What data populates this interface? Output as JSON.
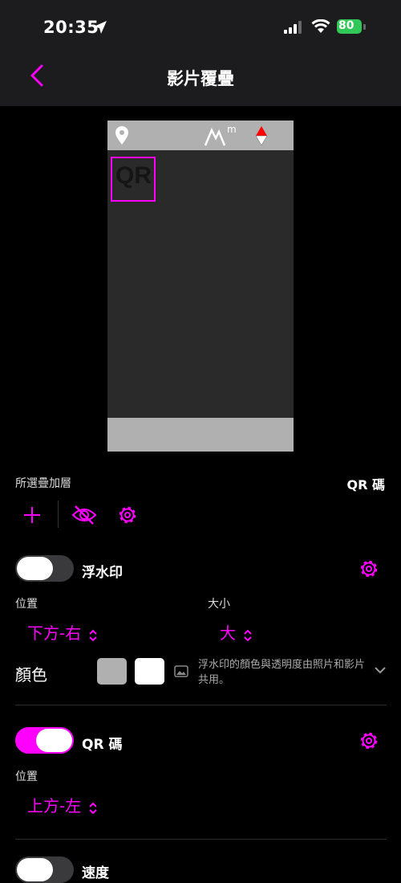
{
  "status": {
    "time": "20:35",
    "battery": "80"
  },
  "nav": {
    "title": "影片覆疊"
  },
  "preview": {
    "overlay_badge": "QR"
  },
  "layers": {
    "label": "所選疊加層",
    "selected": "QR 碼"
  },
  "watermark": {
    "title": "浮水印",
    "enabled": false,
    "position_label": "位置",
    "position_value": "下方-右",
    "size_label": "大小",
    "size_value": "大",
    "color_label": "顏色",
    "color_note": "浮水印的顏色與透明度由照片和影片共用。",
    "swatch1": "#b0b0b0",
    "swatch2": "#ffffff"
  },
  "qrcode": {
    "title": "QR 碼",
    "enabled": true,
    "position_label": "位置",
    "position_value": "上方-左"
  },
  "speed": {
    "title": "速度",
    "enabled": false
  },
  "colors": {
    "accent": "#ff00ff",
    "background": "#000000",
    "bar": "#1c1c1e"
  }
}
